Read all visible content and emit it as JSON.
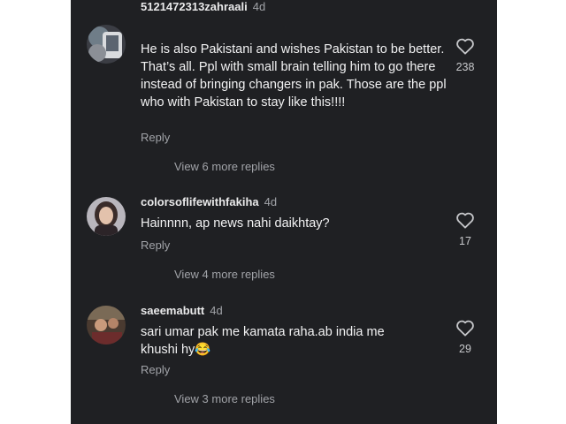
{
  "comments": [
    {
      "username": "5121472313zahraali",
      "time": "4d",
      "text": "He is also Pakistani and wishes Pakistan to be better. That’s all. Ppl with small brain telling him to go there instead of bringing changers in pak. Those are the ppl who with Pakistan to stay like this!!!!",
      "reply_label": "Reply",
      "likes": "238",
      "view_replies": "View 6 more replies",
      "avatar_icon": "profile-photo"
    },
    {
      "username": "colorsoflifewithfakiha",
      "time": "4d",
      "text": "Hainnnn, ap news nahi daikhtay?",
      "reply_label": "Reply",
      "likes": "17",
      "view_replies": "View 4 more replies",
      "avatar_icon": "profile-photo"
    },
    {
      "username": "saeemabutt",
      "time": "4d",
      "text": "sari umar pak me kamata raha.ab india me khushi hy😂",
      "reply_label": "Reply",
      "likes": "29",
      "view_replies": "View 3 more replies",
      "avatar_icon": "profile-photo"
    }
  ],
  "colors": {
    "background": "#1f2023",
    "text_primary": "#f2f2f3",
    "text_secondary": "#a1a3a8"
  },
  "icons": {
    "like": "heart-outline-icon"
  }
}
